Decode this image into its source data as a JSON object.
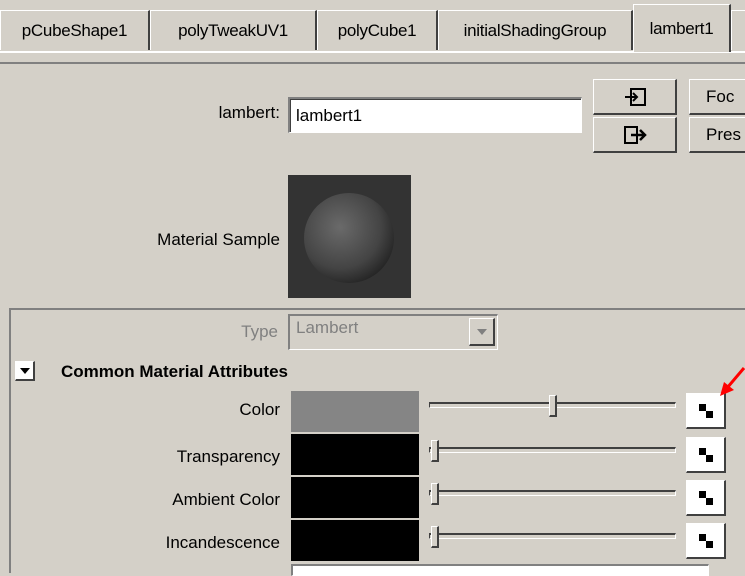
{
  "tabs": [
    {
      "label": "pCubeShape1"
    },
    {
      "label": "polyTweakUV1"
    },
    {
      "label": "polyCube1"
    },
    {
      "label": "initialShadingGroup"
    },
    {
      "label": "lambert1"
    }
  ],
  "header": {
    "material_label": "lambert:",
    "material_name": "lambert1",
    "focus_button": "Foc",
    "presets_button": "Pres",
    "sample_label": "Material Sample"
  },
  "type_row": {
    "label": "Type",
    "value": "Lambert"
  },
  "section": {
    "title": "Common Material Attributes"
  },
  "attributes": [
    {
      "label": "Color",
      "swatch": "#858585",
      "slider_fraction": 0.5
    },
    {
      "label": "Transparency",
      "swatch": "#000000",
      "slider_fraction": 0.0
    },
    {
      "label": "Ambient Color",
      "swatch": "#000000",
      "slider_fraction": 0.0
    },
    {
      "label": "Incandescence",
      "swatch": "#000000",
      "slider_fraction": 0.0
    }
  ],
  "colors": {
    "background": "#d4d0c8",
    "annotation_arrow": "#ff0000"
  }
}
